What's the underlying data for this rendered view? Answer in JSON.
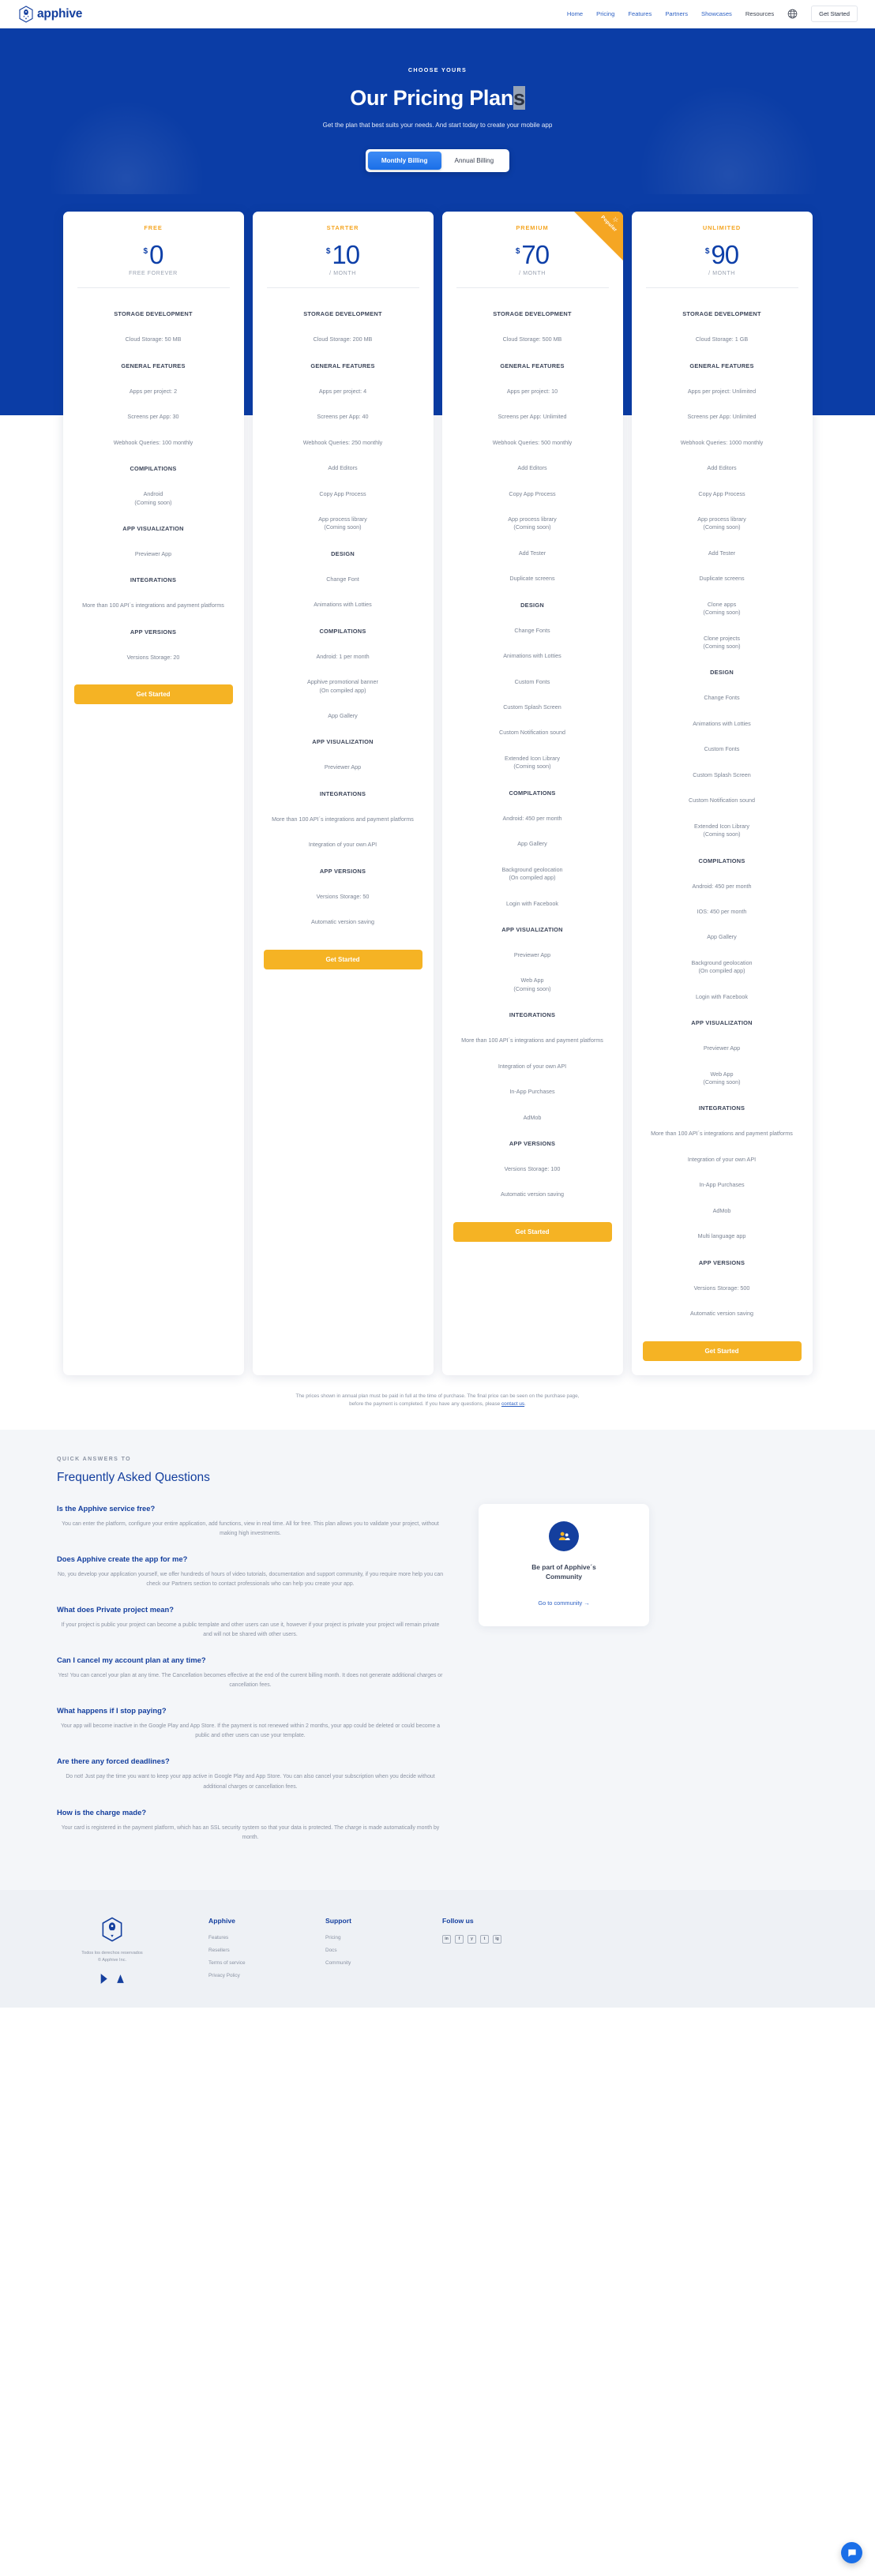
{
  "nav": {
    "brand": "apphive",
    "links": [
      {
        "label": "Home",
        "style": "blue"
      },
      {
        "label": "Pricing",
        "style": "blue"
      },
      {
        "label": "Features",
        "style": "blue"
      },
      {
        "label": "Partners",
        "style": "blue"
      },
      {
        "label": "Showcases",
        "style": "blue"
      },
      {
        "label": "Resources",
        "style": "dark"
      }
    ],
    "globe_icon": "globe-icon",
    "cta": "Get Started"
  },
  "hero": {
    "eyebrow": "CHOOSE YOURS",
    "title_main": "Our Pricing Plan",
    "title_selected": "s",
    "subtitle": "Get the plan that best suits your needs.  And start today to create your mobile app",
    "billing_monthly": "Monthly Billing",
    "billing_annual": "Annual Billing",
    "billing_active": "Monthly Billing"
  },
  "plans": [
    {
      "name": "FREE",
      "currency": "$",
      "amount": "0",
      "period": "FREE FOREVER",
      "popular": false,
      "cta": "Get Started",
      "sections": [
        {
          "head": "STORAGE DEVELOPMENT",
          "items": [
            "Cloud Storage: 50 MB"
          ]
        },
        {
          "head": "GENERAL FEATURES",
          "items": [
            "Apps per project: 2",
            "Screens per App: 30",
            "Webhook Queries: 100 monthly"
          ]
        },
        {
          "head": "COMPILATIONS",
          "items": [
            "Android\n(Coming soon)"
          ]
        },
        {
          "head": "APP VISUALIZATION",
          "items": [
            "Previewer App"
          ]
        },
        {
          "head": "INTEGRATIONS",
          "items": [
            "More than 100 API´s integrations and payment platforms"
          ]
        },
        {
          "head": "APP VERSIONS",
          "items": [
            "Versions Storage: 20"
          ]
        }
      ]
    },
    {
      "name": "STARTER",
      "currency": "$",
      "amount": "10",
      "period": "/ MONTH",
      "popular": false,
      "cta": "Get Started",
      "sections": [
        {
          "head": "STORAGE DEVELOPMENT",
          "items": [
            "Cloud Storage: 200 MB"
          ]
        },
        {
          "head": "GENERAL FEATURES",
          "items": [
            "Apps per project: 4",
            "Screens per App: 40",
            "Webhook Queries: 250 monthly",
            "Add Editors",
            "Copy App Process",
            "App process library\n(Coming soon)"
          ]
        },
        {
          "head": "DESIGN",
          "items": [
            "Change Font",
            "Animations with Lotties"
          ]
        },
        {
          "head": "COMPILATIONS",
          "items": [
            "Android: 1 per month",
            "Apphive promotional banner\n(On compiled app)",
            "App Gallery"
          ]
        },
        {
          "head": "APP VISUALIZATION",
          "items": [
            "Previewer App"
          ]
        },
        {
          "head": "INTEGRATIONS",
          "items": [
            "More than 100 API´s integrations and payment platforms",
            "Integration of your own API"
          ]
        },
        {
          "head": "APP VERSIONS",
          "items": [
            "Versions Storage: 50",
            "Automatic version saving"
          ]
        }
      ]
    },
    {
      "name": "PREMIUM",
      "currency": "$",
      "amount": "70",
      "period": "/ MONTH",
      "popular": true,
      "popular_label": "Popular",
      "cta": "Get Started",
      "sections": [
        {
          "head": "STORAGE DEVELOPMENT",
          "items": [
            "Cloud Storage: 500 MB"
          ]
        },
        {
          "head": "GENERAL FEATURES",
          "items": [
            "Apps per project: 10",
            "Screens per App: Unlimited",
            "Webhook Queries: 500 monthly",
            "Add Editors",
            "Copy App Process",
            "App process library\n(Coming soon)",
            "Add Tester",
            "Duplicate screens"
          ]
        },
        {
          "head": "DESIGN",
          "items": [
            "Change Fonts",
            "Animations with Lotties",
            "Custom Fonts",
            "Custom Splash Screen",
            "Custom Notification sound",
            "Extended Icon Library\n(Coming soon)"
          ]
        },
        {
          "head": "COMPILATIONS",
          "items": [
            "Android: 450 per month",
            "App Gallery",
            "Background geolocation\n(On compiled app)",
            "Login with Facebook"
          ]
        },
        {
          "head": "APP VISUALIZATION",
          "items": [
            "Previewer App",
            "Web App\n(Coming soon)"
          ]
        },
        {
          "head": "INTEGRATIONS",
          "items": [
            "More than 100 API´s integrations and payment platforms",
            "Integration of your own API",
            "In-App Purchases",
            "AdMob"
          ]
        },
        {
          "head": "APP VERSIONS",
          "items": [
            "Versions Storage: 100",
            "Automatic version saving"
          ]
        }
      ]
    },
    {
      "name": "UNLIMITED",
      "currency": "$",
      "amount": "90",
      "period": "/ MONTH",
      "popular": false,
      "cta": "Get Started",
      "sections": [
        {
          "head": "STORAGE DEVELOPMENT",
          "items": [
            "Cloud Storage: 1 GB"
          ]
        },
        {
          "head": "GENERAL FEATURES",
          "items": [
            "Apps per project: Unlimited",
            "Screens per App: Unlimited",
            "Webhook Queries: 1000 monthly",
            "Add Editors",
            "Copy App Process",
            "App process library\n(Coming soon)",
            "Add Tester",
            "Duplicate screens",
            "Clone apps\n(Coming soon)",
            "Clone projects\n(Coming soon)"
          ]
        },
        {
          "head": "DESIGN",
          "items": [
            "Change Fonts",
            "Animations with Lotties",
            "Custom Fonts",
            "Custom Splash Screen",
            "Custom Notification sound",
            "Extended Icon Library\n(Coming soon)"
          ]
        },
        {
          "head": "COMPILATIONS",
          "items": [
            "Android: 450 per month",
            "IOS: 450 per month",
            "App Gallery",
            "Background geolocation\n(On compiled app)",
            "Login with Facebook"
          ]
        },
        {
          "head": "APP VISUALIZATION",
          "items": [
            "Previewer App",
            "Web App\n(Coming soon)"
          ]
        },
        {
          "head": "INTEGRATIONS",
          "items": [
            "More than 100 API´s integrations and payment platforms",
            "Integration of your own API",
            "In-App Purchases",
            "AdMob",
            "Multi language app"
          ]
        },
        {
          "head": "APP VERSIONS",
          "items": [
            "Versions Storage: 500",
            "Automatic version saving"
          ]
        }
      ]
    }
  ],
  "disclaimer": {
    "text": "The prices shown in annual plan must be paid in full at the time of purchase. The final price can be seen on the purchase page, before the payment is completed. If you have any questions, please ",
    "link": "contact us",
    "tail": "."
  },
  "faq": {
    "eyebrow": "QUICK ANSWERS TO",
    "title": "Frequently Asked Questions",
    "items": [
      {
        "q": "Is the Apphive service free?",
        "a": "You can enter the platform, configure your entire application, add functions, view in real time. All for free. This plan allows you to validate your project, without making high investments."
      },
      {
        "q": "Does Apphive create the app for me?",
        "a": "No, you develop your application yourself, we offer hundreds of hours of video tutorials, documentation and support community, if you require more help you can check our Partners section to contact professionals who can help you create your app."
      },
      {
        "q": "What does Private project mean?",
        "a": "If your project is public your project can become a public template and other users can use it, however if your project is private your project will remain private and will not be shared with other users."
      },
      {
        "q": "Can I cancel my account plan at any time?",
        "a": "Yes! You can cancel your plan at any time. The Cancellation becomes effective at the end of the current billing month. It does not generate additional charges or cancellation fees."
      },
      {
        "q": "What happens if I stop paying?",
        "a": "Your app will become inactive in the Google Play and App Store. If the payment is not renewed within 2 months, your app could be deleted or could become a public and other users can use your template."
      },
      {
        "q": "Are there any forced deadlines?",
        "a": "Do not! Just pay the time you want to keep your app active in Google Play and App Store. You can also cancel your subscription when you decide without additional charges or cancellation fees."
      },
      {
        "q": "How is the charge made?",
        "a": "Your card is registered in the payment platform, which has an SSL security system so that your data is protected. The charge is made automatically month by month."
      }
    ],
    "community": {
      "icon": "community-icon",
      "text": "Be part of Apphive´s\nCommunity",
      "link": "Go to community →"
    }
  },
  "footer": {
    "rights": "Todos los derechos reservados\n© Apphive Inc.",
    "store_android": "google-play-icon",
    "store_apple": "app-store-icon",
    "columns": [
      {
        "head": "Apphive",
        "links": [
          "Features",
          "Resellers",
          "Terms of service",
          "Privacy Policy"
        ]
      },
      {
        "head": "Support",
        "links": [
          "Pricing",
          "Docs",
          "Community"
        ]
      }
    ],
    "follow": {
      "head": "Follow us",
      "socials": [
        "in",
        "f",
        "y",
        "t",
        "ig"
      ]
    }
  },
  "chat": {
    "icon": "chat-bubble-icon"
  }
}
